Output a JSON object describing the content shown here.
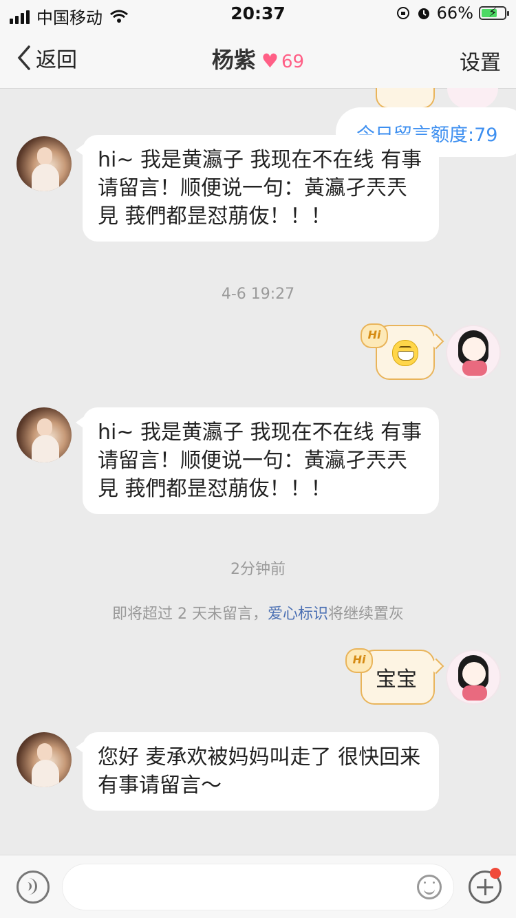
{
  "status_bar": {
    "carrier": "中国移动",
    "time": "20:37",
    "battery": "66%"
  },
  "nav": {
    "back_label": "返回",
    "title": "杨紫",
    "intimacy": "69",
    "settings_label": "设置"
  },
  "quota": "今日留言额度:79",
  "messages": {
    "auto_reply_1": "hi~ 我是黄瀛子 我现在不在线 有事请留言！顺便说一句：黃瀛孑兲兲見 莪們都昰怼萠伖！！！",
    "time_1": "4-6 19:27",
    "auto_reply_2": "hi~ 我是黄瀛子 我现在不在线 有事请留言！顺便说一句：黃瀛孑兲兲見 莪們都昰怼萠伖！！！",
    "time_2": "2分钟前",
    "notice_prefix": "即将超过 2 天未留言，",
    "notice_link": "爱心标识",
    "notice_suffix": "将继续置灰",
    "my_message": "宝宝",
    "reply_3": "您好 麦承欢被妈妈叫走了 很快回来 有事请留言～"
  },
  "badges": {
    "hi": "Hi"
  },
  "input": {
    "placeholder": ""
  },
  "icons": {
    "heart": "heart-icon",
    "grin": "grin-emoji-icon"
  },
  "colors": {
    "accent_heart": "#ff5f86",
    "quota_text": "#3d8ff0",
    "link": "#4a6fb3",
    "my_bubble_border": "#e9b45a"
  }
}
